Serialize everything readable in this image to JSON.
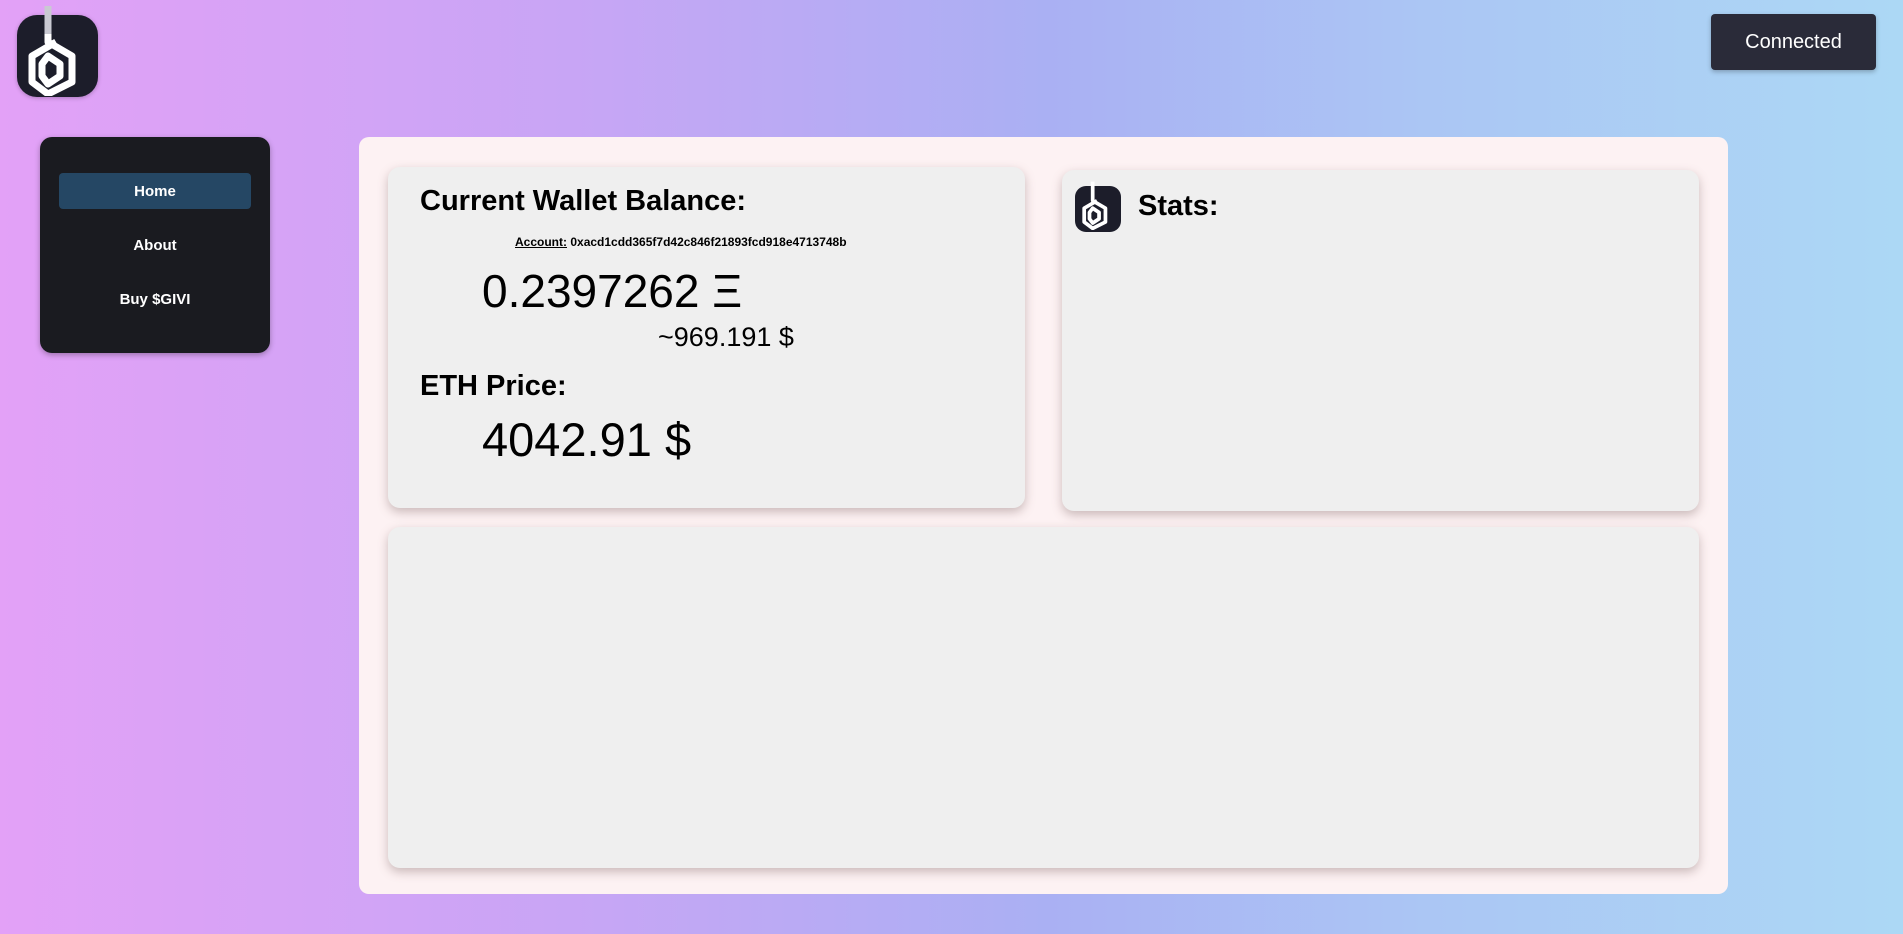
{
  "header": {
    "logo_icon": "givi-logo-icon",
    "connect_label": "Connected"
  },
  "sidebar": {
    "items": [
      {
        "label": "Home",
        "active": true
      },
      {
        "label": "About",
        "active": false
      },
      {
        "label": "Buy $GIVI",
        "active": false
      }
    ]
  },
  "wallet": {
    "title": "Current Wallet Balance:",
    "account_label": "Account:",
    "account_address": "0xacd1cdd365f7d42c846f21893fcd918e4713748b",
    "eth_balance": "0.2397262 Ξ",
    "usd_balance": "~969.191 $",
    "price_title": "ETH Price:",
    "eth_price": "4042.91 $"
  },
  "stats": {
    "icon": "givi-logo-icon",
    "title": "Stats:"
  },
  "colors": {
    "sidebar_bg": "#1a1b20",
    "nav_active": "#254764",
    "button_bg": "#2a2b39",
    "panel_bg": "#fdf2f3",
    "card_bg": "#efefef"
  }
}
